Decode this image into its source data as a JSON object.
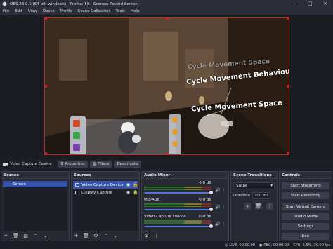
{
  "window": {
    "title": "OBS 28.0.1 (64-bit, windows) - Profile: 55 - Scenes: Record Screen",
    "minimize_glyph": "–",
    "maximize_glyph": "□",
    "close_glyph": "×"
  },
  "menu": [
    "File",
    "Edit",
    "View",
    "Docks",
    "Profile",
    "Scene Collection",
    "Tools",
    "Help"
  ],
  "preview": {
    "overlay_texts": {
      "top": "Cycle Movement Space",
      "middle": "Cycle Movement Behaviour",
      "bottom": "Cycle Movement Space"
    }
  },
  "source_toolbar": {
    "source_name": "Video Capture Device",
    "properties_label": "Properties",
    "filters_label": "Filters",
    "deactivate_label": "Deactivate"
  },
  "docks": {
    "scenes": {
      "title": "Scenes",
      "items": [
        "Screen"
      ]
    },
    "sources": {
      "title": "Sources",
      "items": [
        {
          "name": "Video Capture Device",
          "selected": true
        },
        {
          "name": "Display Capture",
          "selected": false
        }
      ]
    },
    "mixer": {
      "title": "Audio Mixer",
      "channels": [
        {
          "name": "",
          "db": "0.0 dB",
          "level": 1.0
        },
        {
          "name": "Mic/Aux",
          "db": "0.0 dB",
          "level": 1.0
        },
        {
          "name": "Video Capture Device",
          "db": "0.0 dB",
          "level": 1.0
        }
      ]
    },
    "transitions": {
      "title": "Scene Transitions",
      "selected": "Swipe",
      "duration_label": "Duration",
      "duration_value": "300 ms"
    },
    "controls": {
      "title": "Controls",
      "buttons": [
        "Start Streaming",
        "Start Recording",
        "Start Virtual Camera",
        "Studio Mode",
        "Settings",
        "Exit"
      ]
    }
  },
  "status": {
    "live": "LIVE: 00:00:00",
    "rec": "REC: 00:00:00",
    "cpu": "CPU: 6.6%, 30.00 fps"
  },
  "colors": {
    "accent": "#3552a8",
    "selection_border": "#c62828",
    "panel": "#272a33",
    "background": "#1d1f26"
  }
}
